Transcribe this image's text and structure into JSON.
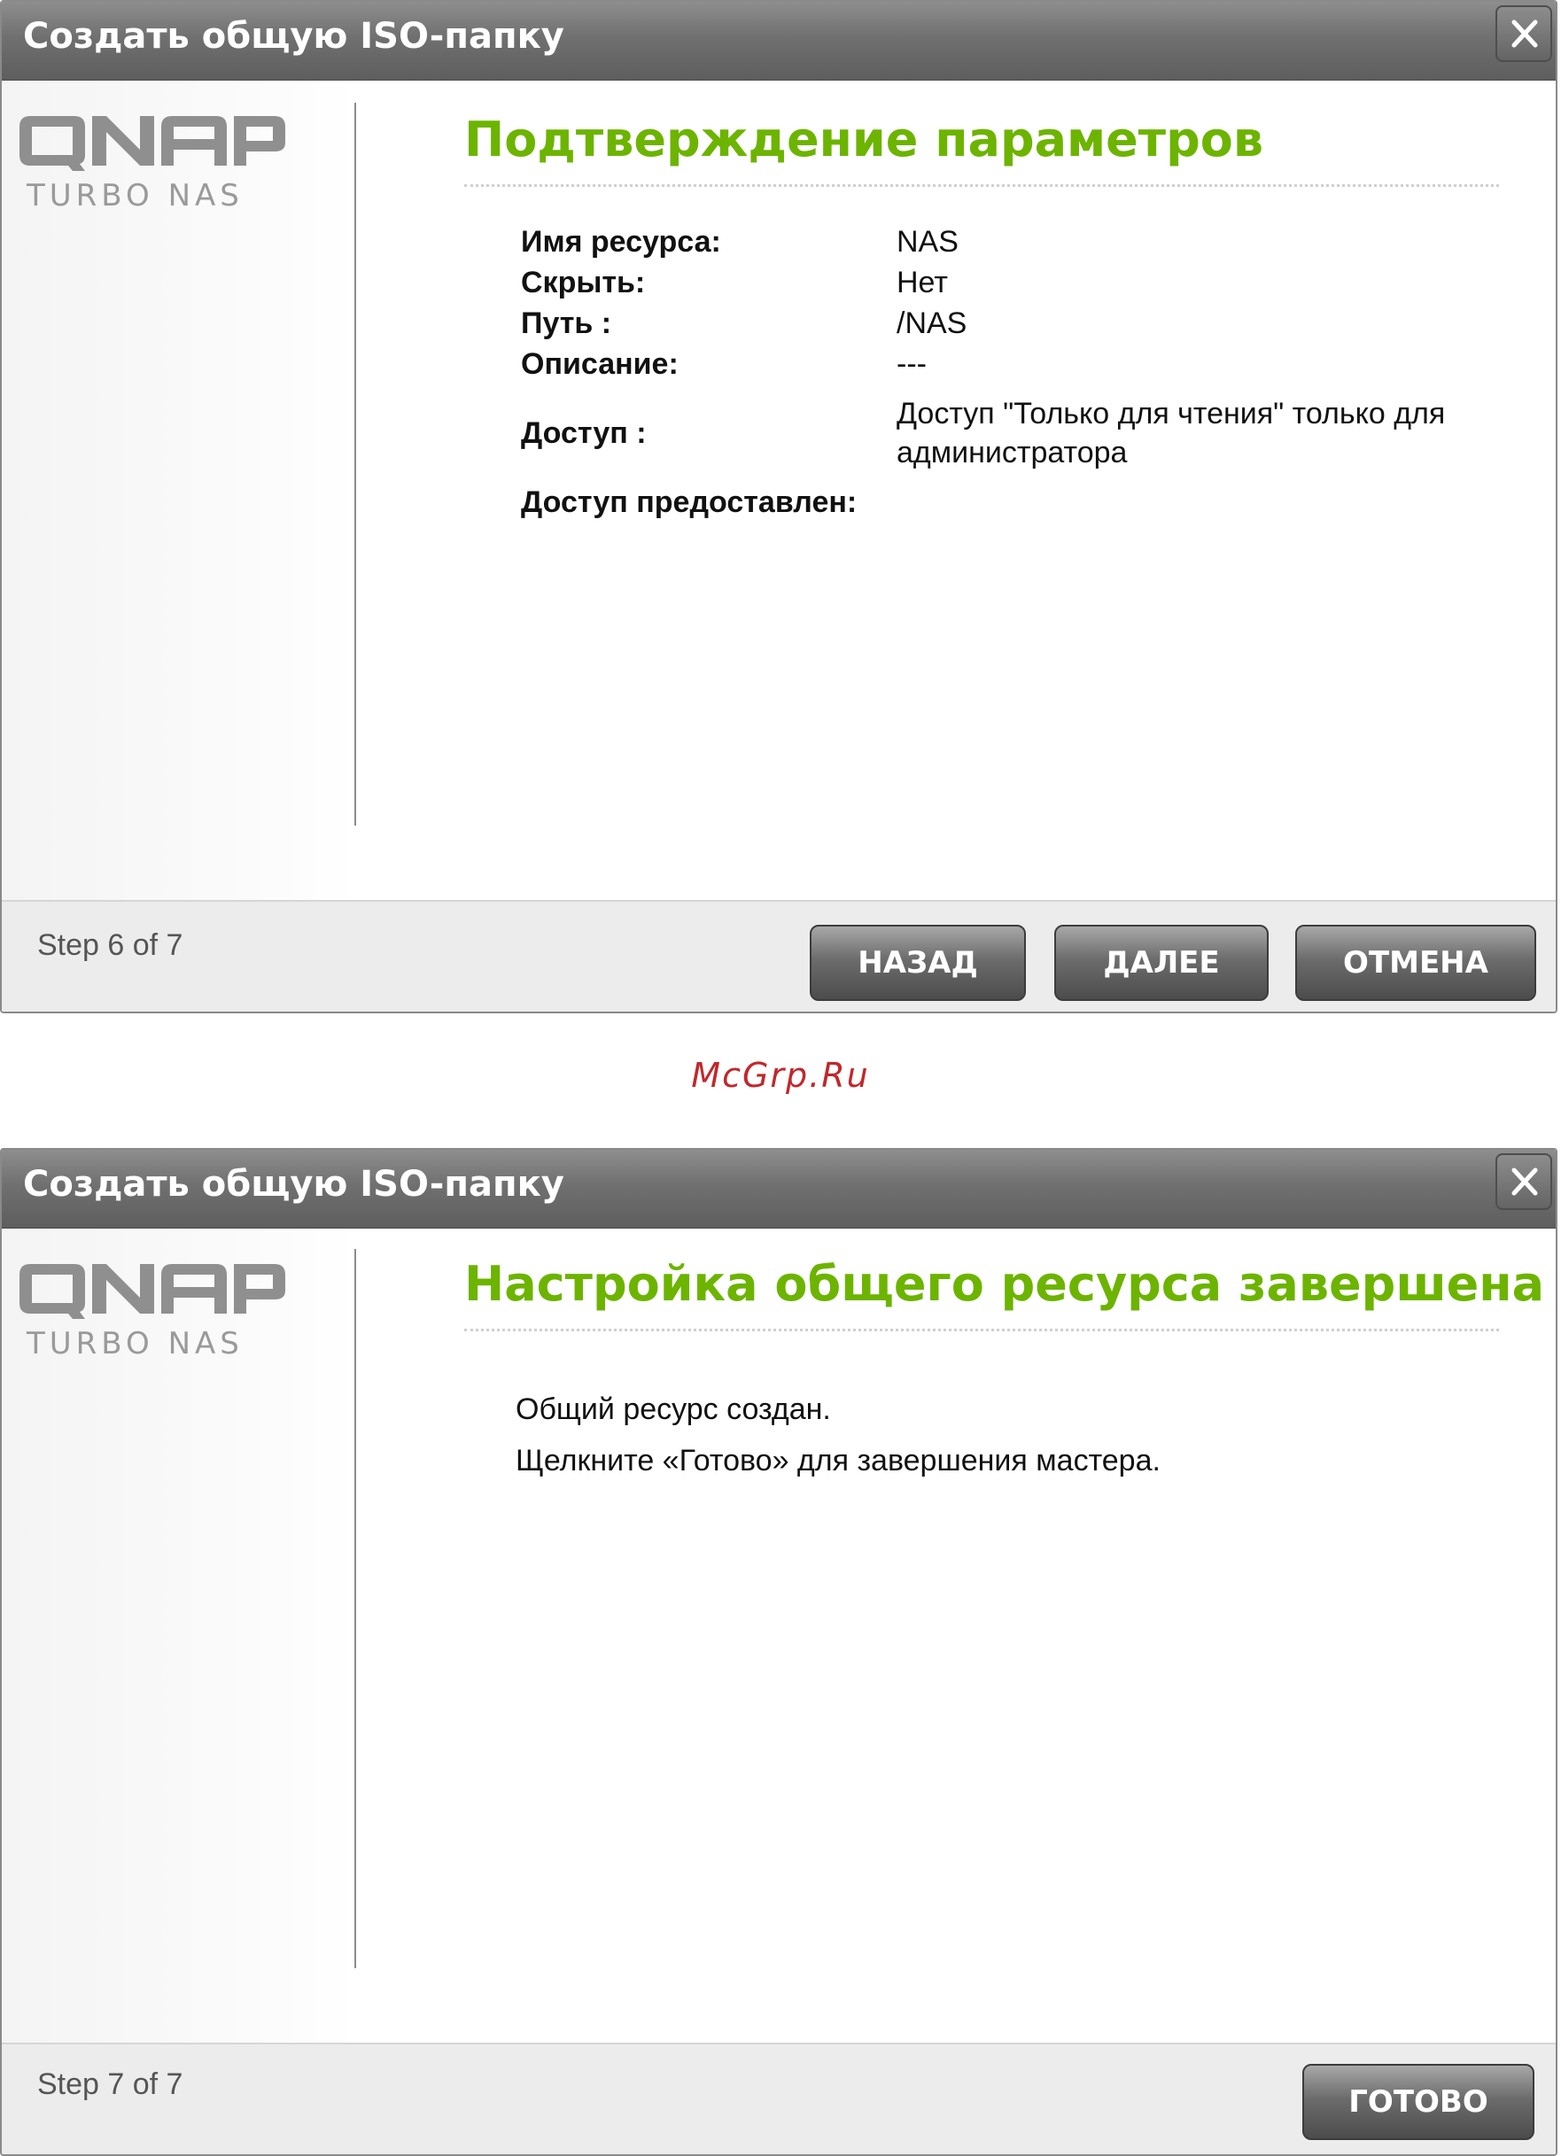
{
  "dialogs": [
    {
      "title": "Создать общую ISO-папку",
      "logo": {
        "brand": "QNAP",
        "sub": "TURBO NAS"
      },
      "heading": "Подтверждение параметров",
      "fields": [
        {
          "label": "Имя ресурса:",
          "value": "NAS"
        },
        {
          "label": "Скрыть:",
          "value": "Нет"
        },
        {
          "label": "Путь :",
          "value": "/NAS"
        },
        {
          "label": "Описание:",
          "value": "---"
        },
        {
          "label": "Доступ :",
          "value": "Доступ \"Только для чтения\" только для администратора"
        },
        {
          "label": "Доступ предоставлен:",
          "value": ""
        }
      ],
      "step": "Step 6 of 7",
      "buttons": {
        "back": "НАЗАД",
        "next": "ДАЛЕЕ",
        "cancel": "ОТМЕНА"
      }
    },
    {
      "title": "Создать общую ISO-папку",
      "logo": {
        "brand": "QNAP",
        "sub": "TURBO NAS"
      },
      "heading": "Настройка общего ресурса завершена",
      "messages": [
        "Общий ресурс создан.",
        "Щелкните «Готово» для завершения мастера."
      ],
      "step": "Step 7 of 7",
      "buttons": {
        "finish": "ГОТОВО"
      }
    }
  ],
  "watermark": "McGrp.Ru",
  "icons": {
    "close": "close-icon",
    "logo": "qnap-logo"
  },
  "colors": {
    "heading": "#6cb400",
    "watermark": "#c0282c",
    "titlebar": "#707070"
  }
}
